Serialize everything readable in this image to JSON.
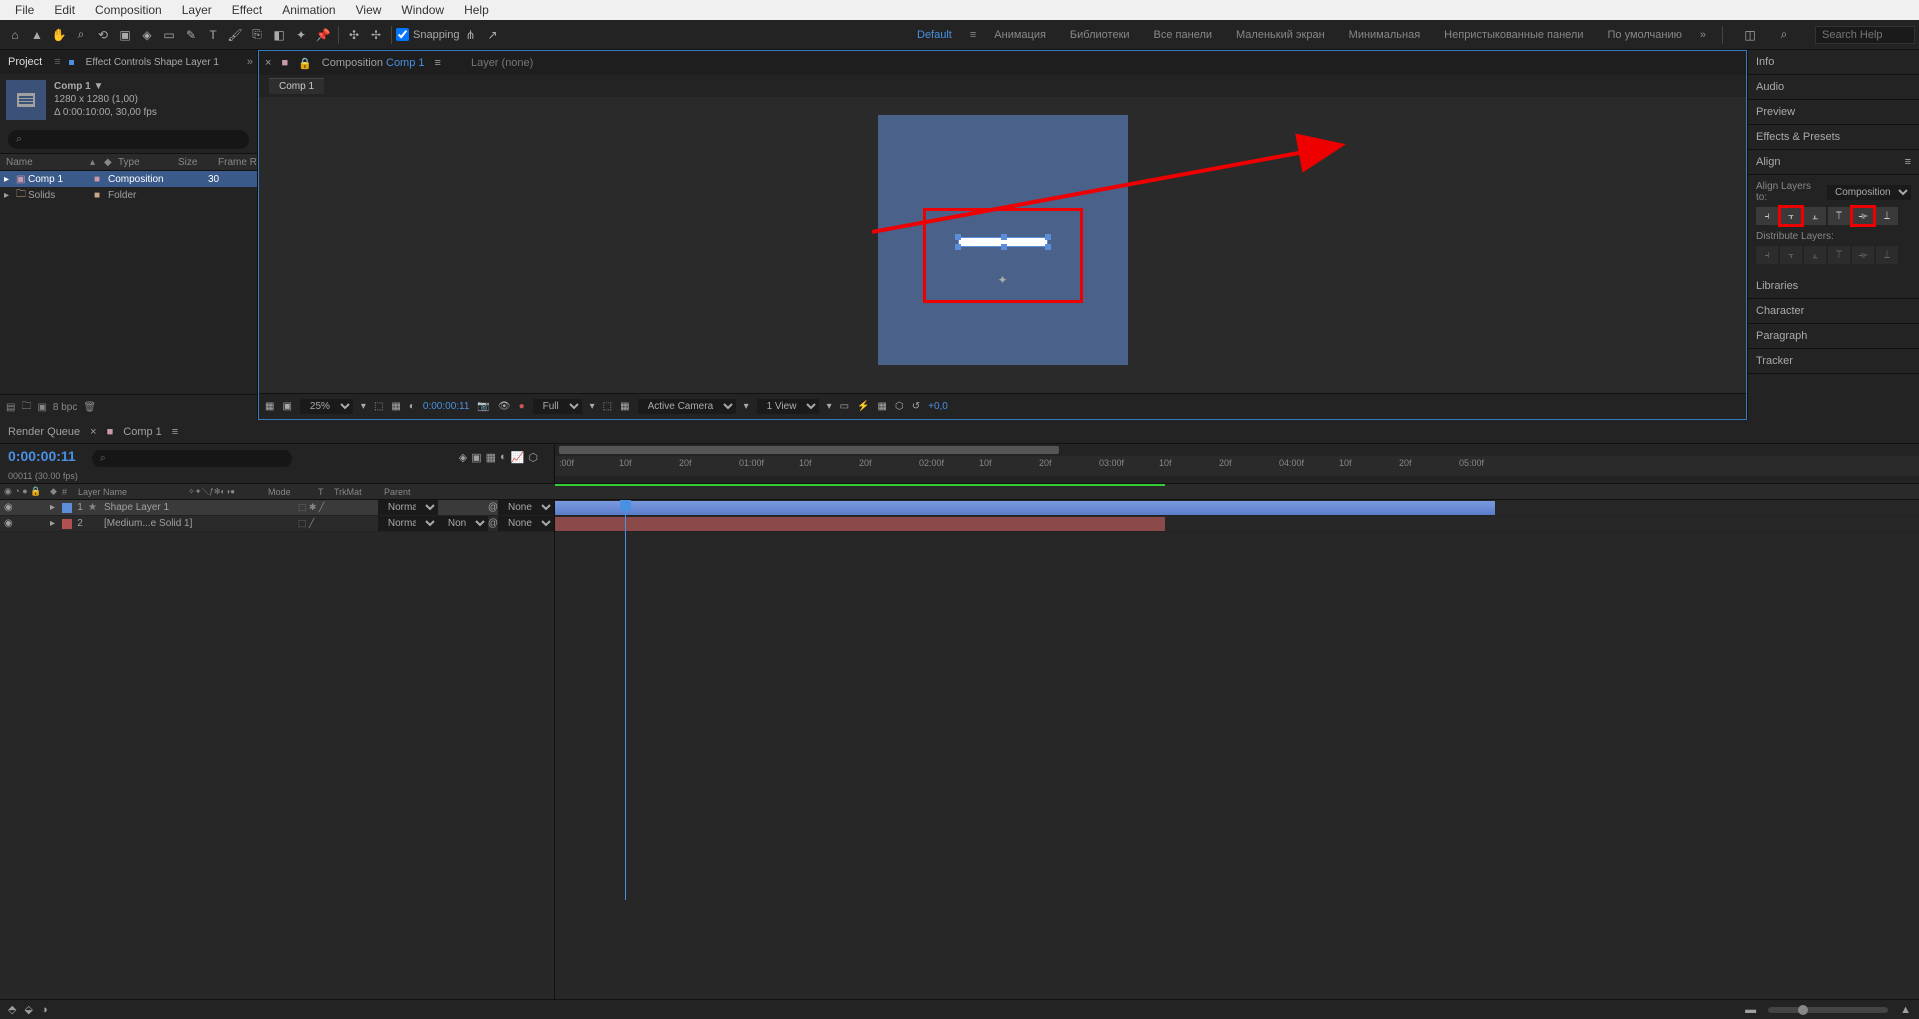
{
  "menubar": [
    "File",
    "Edit",
    "Composition",
    "Layer",
    "Effect",
    "Animation",
    "View",
    "Window",
    "Help"
  ],
  "toolbar": {
    "snapping_label": "Snapping",
    "snapping_checked": true
  },
  "workspaces": {
    "default": "Default",
    "items": [
      "Анимация",
      "Библиотеки",
      "Все панели",
      "Маленький экран",
      "Минимальная",
      "Непристыкованные панели",
      "По умолчанию"
    ],
    "search_placeholder": "Search Help"
  },
  "project_panel": {
    "tab_project": "Project",
    "tab_effect_controls": "Effect Controls Shape Layer 1",
    "comp_name": "Comp 1",
    "comp_arrow": "▼",
    "comp_res": "1280 x 1280 (1,00)",
    "comp_dur": "Δ 0:00:10:00, 30,00 fps",
    "search_icon": "⌕",
    "columns": {
      "name": "Name",
      "type": "Type",
      "size": "Size",
      "frame": "Frame R"
    },
    "items": [
      {
        "name": "Comp 1",
        "type": "Composition",
        "size": "",
        "frame": "30",
        "selected": true,
        "icon": "comp"
      },
      {
        "name": "Solids",
        "type": "Folder",
        "size": "",
        "frame": "",
        "selected": false,
        "icon": "folder"
      }
    ],
    "footer_bpc": "8 bpc"
  },
  "composition_panel": {
    "breadcrumb_label": "Composition",
    "breadcrumb_comp": "Comp 1",
    "layer_label": "Layer (none)",
    "subtab": "Comp 1"
  },
  "viewer_footer": {
    "zoom": "25%",
    "timecode": "0:00:00:11",
    "resolution": "Full",
    "camera": "Active Camera",
    "views": "1 View",
    "exposure": "+0,0"
  },
  "right_panel": {
    "sections": [
      "Info",
      "Audio",
      "Preview",
      "Effects & Presets"
    ],
    "align_title": "Align",
    "align_to_label": "Align Layers to:",
    "align_to_value": "Composition",
    "distribute_label": "Distribute Layers:",
    "lower_sections": [
      "Libraries",
      "Character",
      "Paragraph",
      "Tracker"
    ]
  },
  "timeline": {
    "tab_render": "Render Queue",
    "tab_comp": "Comp 1",
    "timecode": "0:00:00:11",
    "fps_label": "00011 (30.00 fps)",
    "search_icon": "⌕",
    "columns": {
      "num": "#",
      "name": "Layer Name",
      "mode": "Mode",
      "trkmat": "TrkMat",
      "parent": "Parent",
      "t": "T"
    },
    "ruler_marks": [
      ":00f",
      "10f",
      "20f",
      "01:00f",
      "10f",
      "20f",
      "02:00f",
      "10f",
      "20f",
      "03:00f",
      "10f",
      "20f",
      "04:00f",
      "10f",
      "20f",
      "05:00f"
    ],
    "layers": [
      {
        "num": "1",
        "name": "Shape Layer 1",
        "mode": "Normal",
        "trkmat": "",
        "parent": "None",
        "color": "#5b8dd8",
        "selected": true,
        "bar_color": "#6b8dd8"
      },
      {
        "num": "2",
        "name": "[Medium...e Solid 1]",
        "mode": "Normal",
        "trkmat": "None",
        "parent": "None",
        "color": "#b05050",
        "selected": false,
        "bar_color": "#8a4a4a"
      }
    ]
  }
}
